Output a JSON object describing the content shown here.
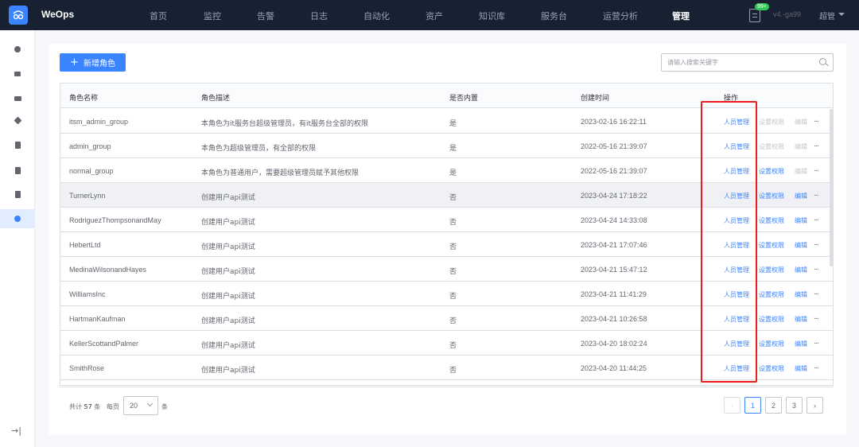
{
  "header": {
    "brand": "WeOps",
    "nav": [
      "首页",
      "监控",
      "告警",
      "日志",
      "自动化",
      "资产",
      "知识库",
      "服务台",
      "运营分析",
      "管理"
    ],
    "active_nav": "管理",
    "notice_badge": "99+",
    "version": "v4.-ga99",
    "user": "超管"
  },
  "sidebar": {
    "icons": [
      "camera-icon",
      "dashboard-icon",
      "toolbox-icon",
      "layers-icon",
      "book-icon",
      "clipboard-icon",
      "clipboard-check-icon",
      "shield-icon"
    ],
    "active_index": 7
  },
  "toolbar": {
    "add_label": "新增角色",
    "search_placeholder": "请输入搜索关键字"
  },
  "table": {
    "columns": [
      "角色名称",
      "角色描述",
      "是否内置",
      "创建时间",
      "操作"
    ],
    "actions": [
      "人员管理",
      "设置权限",
      "编辑",
      "..."
    ],
    "rows": [
      {
        "name": "itsm_admin_group",
        "desc": "本角色为it服务台超级管理员，有it服务台全部的权限",
        "builtin": "是",
        "created": "2023-02-16 16:22:11",
        "perm_enabled": false,
        "edit_enabled": false
      },
      {
        "name": "admin_group",
        "desc": "本角色为超级管理员，有全部的权限",
        "builtin": "是",
        "created": "2022-05-16 21:39:07",
        "perm_enabled": false,
        "edit_enabled": false
      },
      {
        "name": "normal_group",
        "desc": "本角色为普通用户，需要超级管理员赋予其他权限",
        "builtin": "是",
        "created": "2022-05-16 21:39:07",
        "perm_enabled": true,
        "edit_enabled": false
      },
      {
        "name": "TurnerLynn",
        "desc": "创建用户api测试",
        "builtin": "否",
        "created": "2023-04-24 17:18:22",
        "perm_enabled": true,
        "edit_enabled": true
      },
      {
        "name": "RodriguezThompsonandMay",
        "desc": "创建用户api测试",
        "builtin": "否",
        "created": "2023-04-24 14:33:08",
        "perm_enabled": true,
        "edit_enabled": true
      },
      {
        "name": "HebertLtd",
        "desc": "创建用户api测试",
        "builtin": "否",
        "created": "2023-04-21 17:07:46",
        "perm_enabled": true,
        "edit_enabled": true
      },
      {
        "name": "MedinaWilsonandHayes",
        "desc": "创建用户api测试",
        "builtin": "否",
        "created": "2023-04-21 15:47:12",
        "perm_enabled": true,
        "edit_enabled": true
      },
      {
        "name": "WilliamsInc",
        "desc": "创建用户api测试",
        "builtin": "否",
        "created": "2023-04-21 11:41:29",
        "perm_enabled": true,
        "edit_enabled": true
      },
      {
        "name": "HartmanKaufman",
        "desc": "创建用户api测试",
        "builtin": "否",
        "created": "2023-04-21 10:26:58",
        "perm_enabled": true,
        "edit_enabled": true
      },
      {
        "name": "KellerScottandPalmer",
        "desc": "创建用户api测试",
        "builtin": "否",
        "created": "2023-04-20 18:02:24",
        "perm_enabled": true,
        "edit_enabled": true
      },
      {
        "name": "SmithRose",
        "desc": "创建用户api测试",
        "builtin": "否",
        "created": "2023-04-20 11:44:25",
        "perm_enabled": true,
        "edit_enabled": true
      }
    ],
    "hover_row": 3
  },
  "pagination": {
    "total_prefix": "共计",
    "total": "57",
    "total_suffix": "条",
    "per_page_label": "每页",
    "page_size": "20",
    "unit": "条",
    "pages": [
      "1",
      "2",
      "3"
    ],
    "current": "1",
    "prev": "‹",
    "next": "›"
  },
  "colors": {
    "primary": "#3a84ff",
    "nav_bg": "#182132",
    "highlight": "#ea1d1d",
    "badge": "#2dcb56"
  }
}
